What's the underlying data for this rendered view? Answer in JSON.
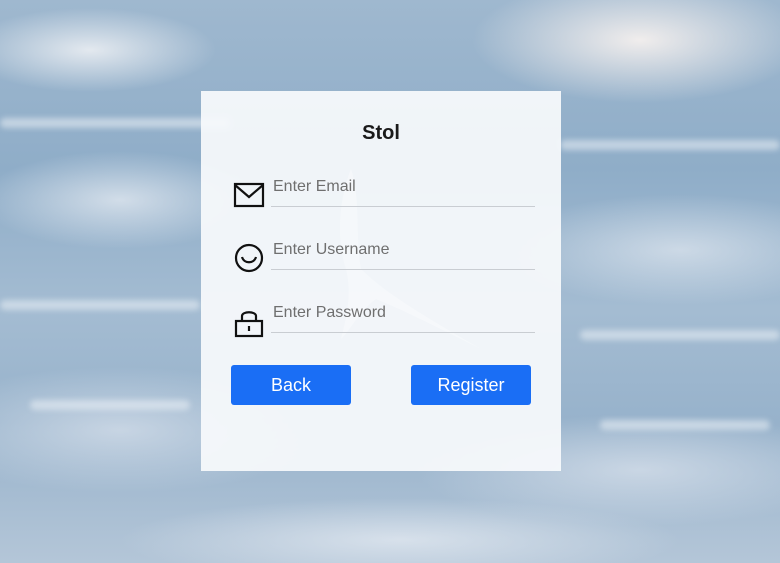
{
  "app": {
    "title": "Stol"
  },
  "form": {
    "email": {
      "placeholder": "Enter Email",
      "value": "",
      "icon": "mail-icon"
    },
    "username": {
      "placeholder": "Enter Username",
      "value": "",
      "icon": "smile-icon"
    },
    "password": {
      "placeholder": "Enter Password",
      "value": "",
      "icon": "lock-icon"
    }
  },
  "buttons": {
    "back_label": "Back",
    "register_label": "Register"
  },
  "colors": {
    "accent": "#1a6ef5",
    "card": "#f8fafc",
    "text": "#1a1a1a"
  }
}
